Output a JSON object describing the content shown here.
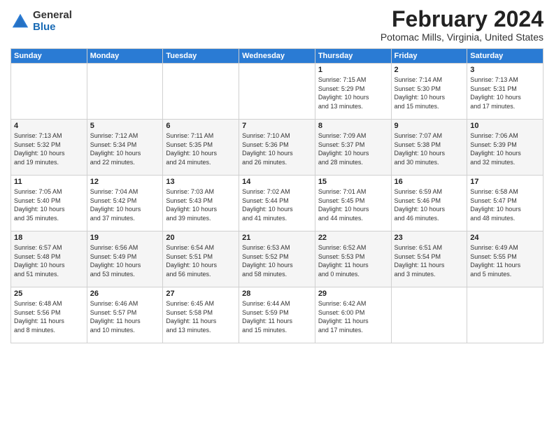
{
  "header": {
    "logo_general": "General",
    "logo_blue": "Blue",
    "title": "February 2024",
    "subtitle": "Potomac Mills, Virginia, United States"
  },
  "days_of_week": [
    "Sunday",
    "Monday",
    "Tuesday",
    "Wednesday",
    "Thursday",
    "Friday",
    "Saturday"
  ],
  "weeks": [
    [
      {
        "num": "",
        "info": ""
      },
      {
        "num": "",
        "info": ""
      },
      {
        "num": "",
        "info": ""
      },
      {
        "num": "",
        "info": ""
      },
      {
        "num": "1",
        "info": "Sunrise: 7:15 AM\nSunset: 5:29 PM\nDaylight: 10 hours\nand 13 minutes."
      },
      {
        "num": "2",
        "info": "Sunrise: 7:14 AM\nSunset: 5:30 PM\nDaylight: 10 hours\nand 15 minutes."
      },
      {
        "num": "3",
        "info": "Sunrise: 7:13 AM\nSunset: 5:31 PM\nDaylight: 10 hours\nand 17 minutes."
      }
    ],
    [
      {
        "num": "4",
        "info": "Sunrise: 7:13 AM\nSunset: 5:32 PM\nDaylight: 10 hours\nand 19 minutes."
      },
      {
        "num": "5",
        "info": "Sunrise: 7:12 AM\nSunset: 5:34 PM\nDaylight: 10 hours\nand 22 minutes."
      },
      {
        "num": "6",
        "info": "Sunrise: 7:11 AM\nSunset: 5:35 PM\nDaylight: 10 hours\nand 24 minutes."
      },
      {
        "num": "7",
        "info": "Sunrise: 7:10 AM\nSunset: 5:36 PM\nDaylight: 10 hours\nand 26 minutes."
      },
      {
        "num": "8",
        "info": "Sunrise: 7:09 AM\nSunset: 5:37 PM\nDaylight: 10 hours\nand 28 minutes."
      },
      {
        "num": "9",
        "info": "Sunrise: 7:07 AM\nSunset: 5:38 PM\nDaylight: 10 hours\nand 30 minutes."
      },
      {
        "num": "10",
        "info": "Sunrise: 7:06 AM\nSunset: 5:39 PM\nDaylight: 10 hours\nand 32 minutes."
      }
    ],
    [
      {
        "num": "11",
        "info": "Sunrise: 7:05 AM\nSunset: 5:40 PM\nDaylight: 10 hours\nand 35 minutes."
      },
      {
        "num": "12",
        "info": "Sunrise: 7:04 AM\nSunset: 5:42 PM\nDaylight: 10 hours\nand 37 minutes."
      },
      {
        "num": "13",
        "info": "Sunrise: 7:03 AM\nSunset: 5:43 PM\nDaylight: 10 hours\nand 39 minutes."
      },
      {
        "num": "14",
        "info": "Sunrise: 7:02 AM\nSunset: 5:44 PM\nDaylight: 10 hours\nand 41 minutes."
      },
      {
        "num": "15",
        "info": "Sunrise: 7:01 AM\nSunset: 5:45 PM\nDaylight: 10 hours\nand 44 minutes."
      },
      {
        "num": "16",
        "info": "Sunrise: 6:59 AM\nSunset: 5:46 PM\nDaylight: 10 hours\nand 46 minutes."
      },
      {
        "num": "17",
        "info": "Sunrise: 6:58 AM\nSunset: 5:47 PM\nDaylight: 10 hours\nand 48 minutes."
      }
    ],
    [
      {
        "num": "18",
        "info": "Sunrise: 6:57 AM\nSunset: 5:48 PM\nDaylight: 10 hours\nand 51 minutes."
      },
      {
        "num": "19",
        "info": "Sunrise: 6:56 AM\nSunset: 5:49 PM\nDaylight: 10 hours\nand 53 minutes."
      },
      {
        "num": "20",
        "info": "Sunrise: 6:54 AM\nSunset: 5:51 PM\nDaylight: 10 hours\nand 56 minutes."
      },
      {
        "num": "21",
        "info": "Sunrise: 6:53 AM\nSunset: 5:52 PM\nDaylight: 10 hours\nand 58 minutes."
      },
      {
        "num": "22",
        "info": "Sunrise: 6:52 AM\nSunset: 5:53 PM\nDaylight: 11 hours\nand 0 minutes."
      },
      {
        "num": "23",
        "info": "Sunrise: 6:51 AM\nSunset: 5:54 PM\nDaylight: 11 hours\nand 3 minutes."
      },
      {
        "num": "24",
        "info": "Sunrise: 6:49 AM\nSunset: 5:55 PM\nDaylight: 11 hours\nand 5 minutes."
      }
    ],
    [
      {
        "num": "25",
        "info": "Sunrise: 6:48 AM\nSunset: 5:56 PM\nDaylight: 11 hours\nand 8 minutes."
      },
      {
        "num": "26",
        "info": "Sunrise: 6:46 AM\nSunset: 5:57 PM\nDaylight: 11 hours\nand 10 minutes."
      },
      {
        "num": "27",
        "info": "Sunrise: 6:45 AM\nSunset: 5:58 PM\nDaylight: 11 hours\nand 13 minutes."
      },
      {
        "num": "28",
        "info": "Sunrise: 6:44 AM\nSunset: 5:59 PM\nDaylight: 11 hours\nand 15 minutes."
      },
      {
        "num": "29",
        "info": "Sunrise: 6:42 AM\nSunset: 6:00 PM\nDaylight: 11 hours\nand 17 minutes."
      },
      {
        "num": "",
        "info": ""
      },
      {
        "num": "",
        "info": ""
      }
    ]
  ]
}
